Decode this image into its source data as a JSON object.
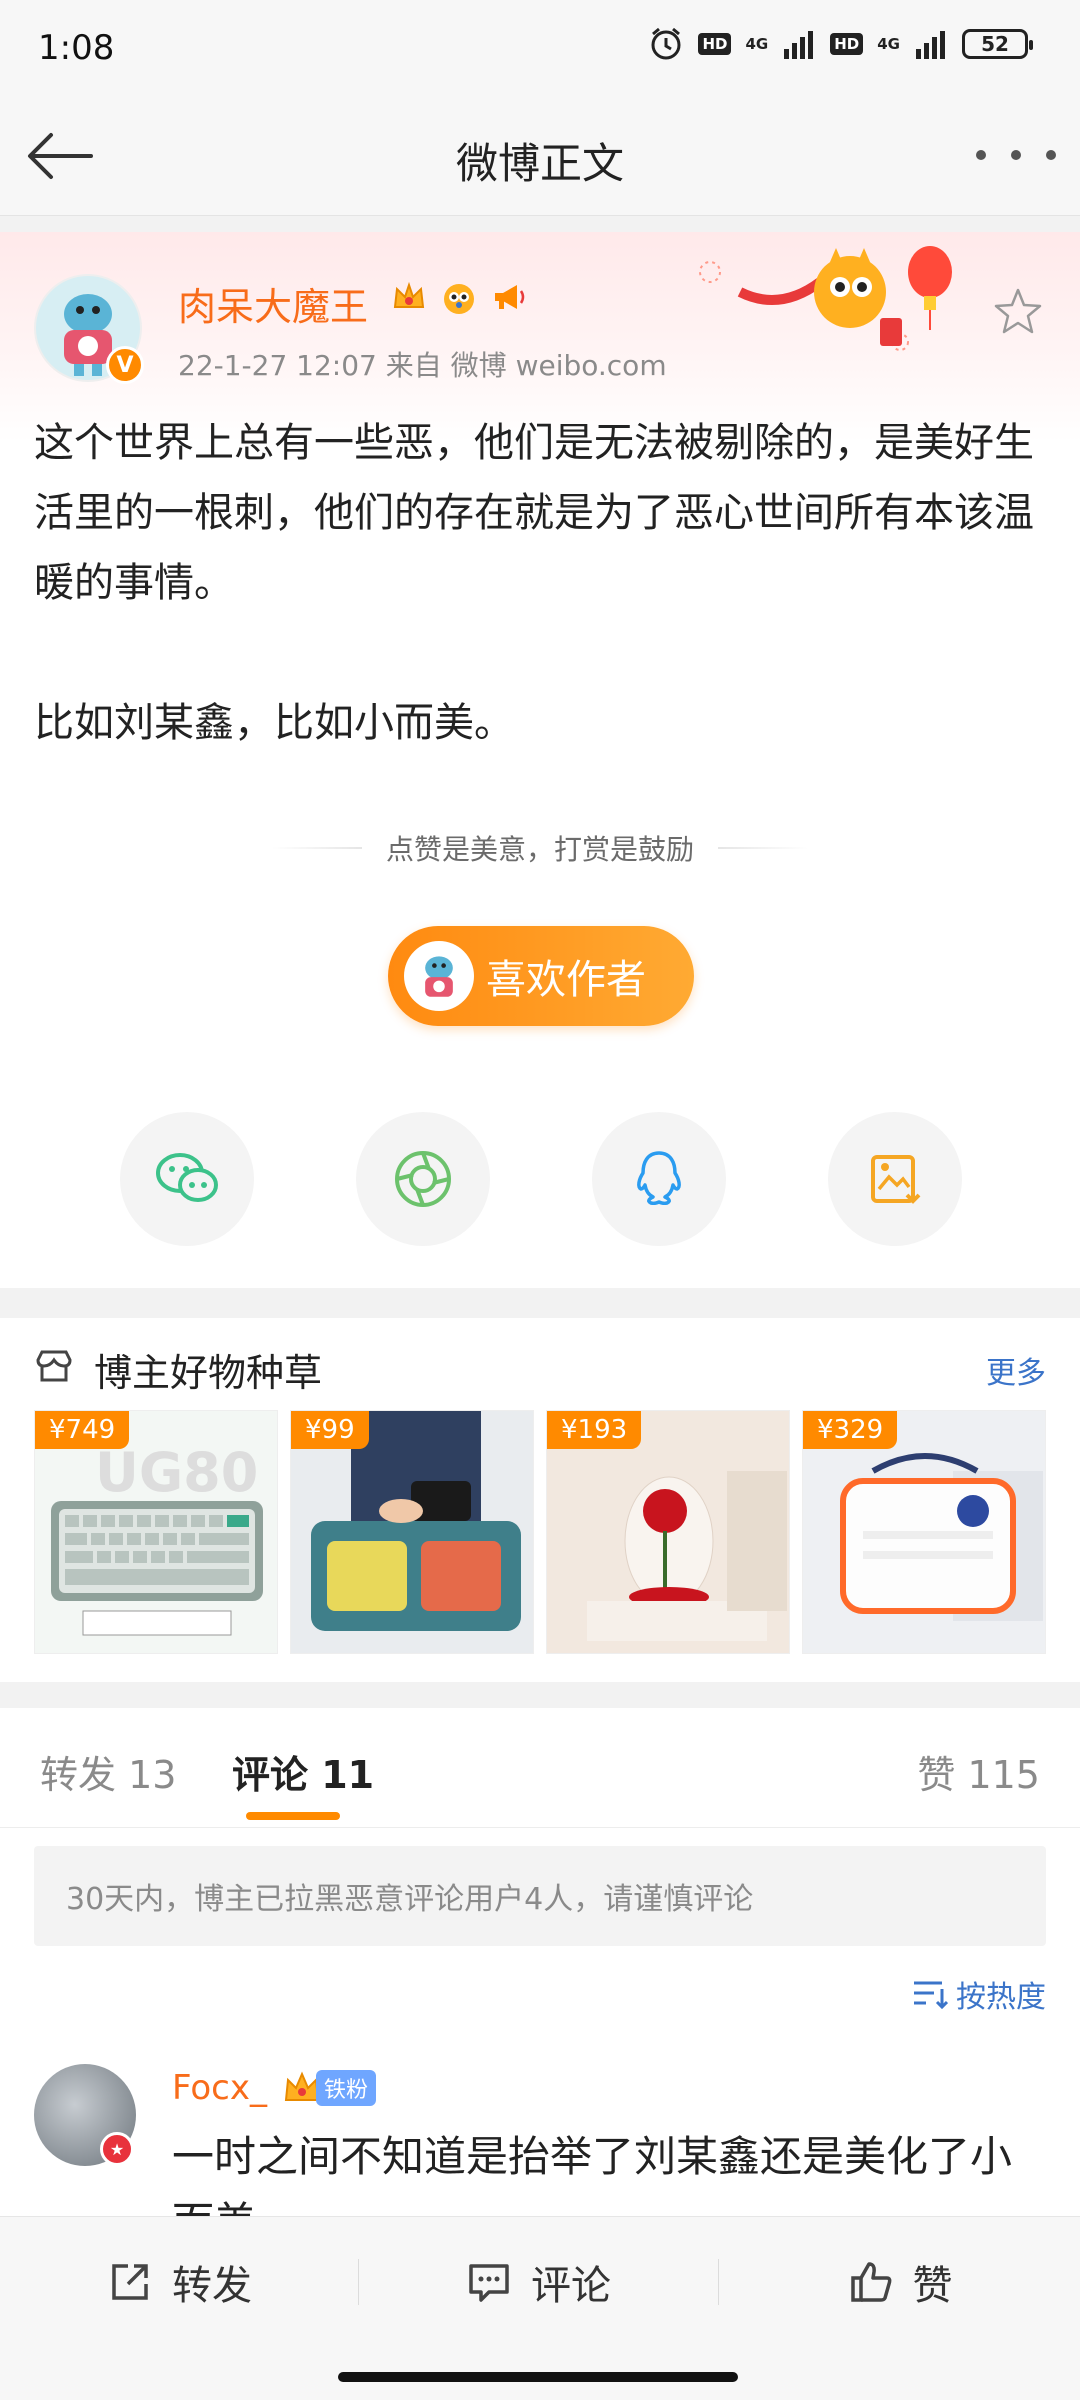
{
  "status": {
    "time": "1:08",
    "battery": "52",
    "net1": "4G",
    "net2": "4G",
    "hd": "HD"
  },
  "nav": {
    "title": "微博正文"
  },
  "post": {
    "author": "肉呆大魔王",
    "meta": "22-1-27 12:07  来自 微博 weibo.com",
    "paragraphs": [
      "这个世界上总有一些恶，他们是无法被剔除的，是美好生活里的一根刺，他们的存在就是为了恶心世间所有本该温暖的事情。",
      "",
      "比如刘某鑫，比如小而美。"
    ],
    "tip": "点赞是美意，打赏是鼓励",
    "like_author_label": "喜欢作者"
  },
  "share_icons": [
    "wechat-icon",
    "moments-icon",
    "qq-icon",
    "save-image-icon"
  ],
  "goods": {
    "title": "博主好物种草",
    "more": "更多",
    "items": [
      {
        "price": "¥749"
      },
      {
        "price": "¥99"
      },
      {
        "price": "¥193"
      },
      {
        "price": "¥329"
      }
    ]
  },
  "tabs": {
    "repost": "转发 13",
    "comments": "评论 11",
    "likes": "赞 115"
  },
  "notice": "30天内，博主已拉黑恶意评论用户4人，请谨慎评论",
  "sort_label": "按热度",
  "comment": {
    "name": "Focx_",
    "fan_label": "铁粉",
    "text": "一时之间不知道是抬举了刘某鑫还是美化了小而美"
  },
  "bottom": {
    "repost": "转发",
    "comment": "评论",
    "like": "赞"
  },
  "colors": {
    "accent": "#ff8a00",
    "link": "#3b74c9",
    "username": "#f86c1a"
  }
}
